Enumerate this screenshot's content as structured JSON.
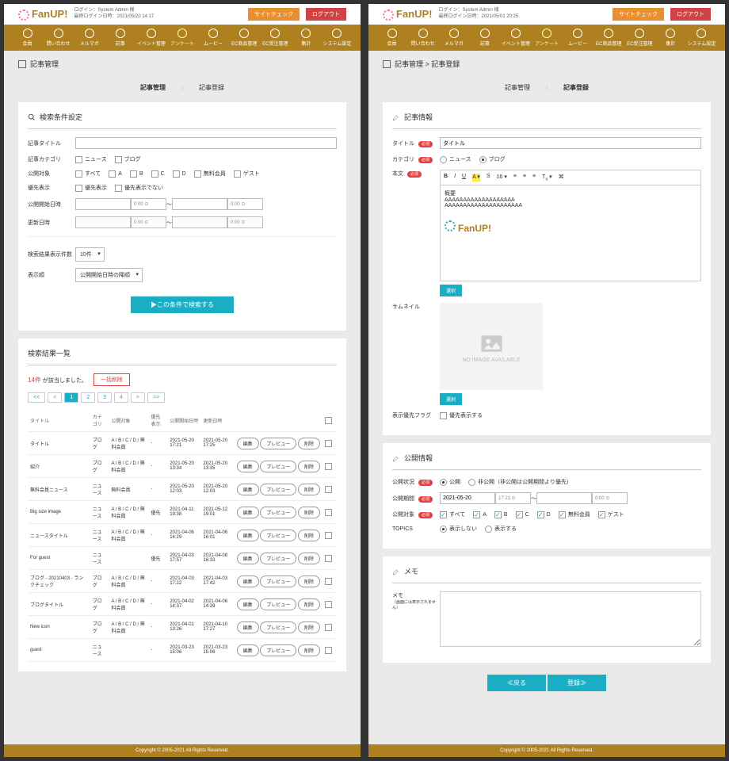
{
  "hdr": {
    "login": "ログイン：System Admin 様",
    "last1": "最終ログイン日時：2021/05/20 14:17",
    "last2": "最終ログイン日時：2021/05/01 20:25",
    "site": "サイトチェック",
    "logout": "ログアウト",
    "logo": "FanUP!"
  },
  "nav": [
    "会員",
    "問い合わせ",
    "メルマガ",
    "記事",
    "イベント管理",
    "アンケート",
    "ムービー",
    "EC商品管理",
    "EC受注管理",
    "集計",
    "システム設定"
  ],
  "L": {
    "bc": "記事管理",
    "tab1": "記事管理",
    "tab2": "記事登録",
    "p1": {
      "title": "検索条件設定",
      "l_title": "記事タイトル",
      "l_cat": "記事カテゴリ",
      "cat1": "ニュース",
      "cat2": "ブログ",
      "l_tgt": "公開対象",
      "o_all": "すべて",
      "o_free": "無料会員",
      "o_guest": "ゲスト",
      "l_pri": "優先表示",
      "pri1": "優先表示",
      "pri2": "優先表示でない",
      "l_start": "公開開始日時",
      "l_upd": "更新日時",
      "tph": "0:00",
      "l_cnt": "検索結果表示件数",
      "cnt": "10件",
      "l_ord": "表示順",
      "ord": "公開開始日時の降順",
      "search": "▶この条件で検索する"
    },
    "p2": {
      "title": "検索結果一覧",
      "hits": "14件",
      "hitslbl": "が該当しました。",
      "bulk": "一括削除",
      "pages": [
        "<<",
        "<",
        "1",
        "2",
        "3",
        "4",
        ">",
        ">>"
      ],
      "th": [
        "タイトル",
        "カテゴリ",
        "公開対象",
        "優先表示",
        "公開開始日時",
        "更新日時"
      ],
      "btns": {
        "e": "編集",
        "p": "プレビュー",
        "d": "削除"
      },
      "rows": [
        [
          "タイトル",
          "ブログ",
          "A / B / C / D / 無料会員",
          "-",
          "2021-05-20 17:21",
          "2021-05-20 17:25"
        ],
        [
          "紹介",
          "ブログ",
          "A / B / C / D / 無料会員",
          "-",
          "2021-05-20 13:34",
          "2021-05-20 13:35"
        ],
        [
          "無料会員ニュース",
          "ニュース",
          "無料会員",
          "-",
          "2021-05-20 12:03",
          "2021-05-20 12:03"
        ],
        [
          "Big size image",
          "ニュース",
          "A / B / C / D / 無料会員",
          "優先",
          "2021-04-11 19:38",
          "2021-05-12 19:01"
        ],
        [
          "ニュースタイトル",
          "ニュース",
          "A / B / C / D / 無料会員",
          "-",
          "2021-04-06 14:29",
          "2021-04-06 16:01"
        ],
        [
          "For guest",
          "ニュース",
          "",
          "優先",
          "2021-04-03 17:57",
          "2021-04-08 16:33"
        ],
        [
          "ブログ - 20210403 - ランクチェック",
          "ブログ",
          "A / B / C / D / 無料会員",
          "-",
          "2021-04-03 17:22",
          "2021-04-03 17:42"
        ],
        [
          "ブログタイトル",
          "ブログ",
          "A / B / C / D / 無料会員",
          "-",
          "2021-04-02 14:37",
          "2021-04-06 14:39"
        ],
        [
          "New icon",
          "ブログ",
          "A / B / C / D / 無料会員",
          "-",
          "2021-04-01 13:26",
          "2021-04-10 17:27"
        ],
        [
          "guest",
          "ニュース",
          "",
          "-",
          "2021-03-23 15:06",
          "2021-03-23 15:06"
        ]
      ]
    }
  },
  "R": {
    "bc": "記事管理 > 記事登録",
    "tab1": "記事管理",
    "tab2": "記事登録",
    "p1": {
      "title": "記事情報",
      "l_title": "タイトル",
      "v_title": "タイトル",
      "l_cat": "カテゴリ",
      "cat1": "ニュース",
      "cat2": "ブログ",
      "l_body": "本文",
      "body": "概要\nAAAAAAAAAAAAAAAAAAA\nAAAAAAAAAAAAAAAAAAAAA",
      "sel": "選択",
      "l_thumb": "サムネイル",
      "noimg": "NO IMAGE AVAILABLE",
      "l_flag": "表示優先フラグ",
      "flag": "優先表示する"
    },
    "p2": {
      "title": "公開情報",
      "l_stat": "公開状況",
      "s1": "公開",
      "s2": "非公開（非公開は公開期間より優先）",
      "l_term": "公開期間",
      "d1": "2021-05-20",
      "t1": "17:21",
      "tph": "0:00",
      "l_tgt": "公開対象",
      "o_all": "すべて",
      "o_free": "無料会員",
      "o_guest": "ゲスト",
      "l_top": "TOPICS",
      "tp1": "表示しない",
      "tp2": "表示する"
    },
    "p3": {
      "title": "メモ",
      "l": "メモ",
      "sub": "（画面には表示されません）"
    },
    "back": "≪戻る",
    "submit": "登録≫"
  },
  "foot": "Copyright © 2005-2021 All Rights Reserved.",
  "req": "必須"
}
